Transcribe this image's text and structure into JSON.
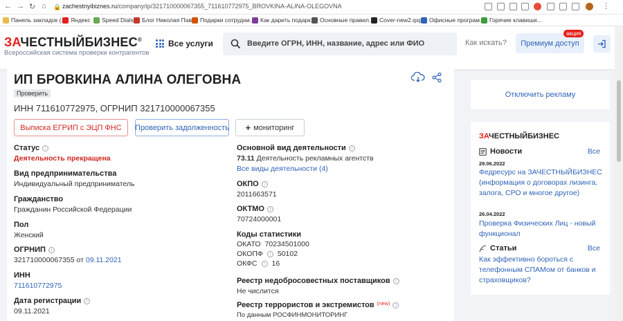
{
  "browser": {
    "url_host": "zachestnyibiznes.ru",
    "url_path": "/company/ip/321710000067355_711610772975_BROVKINA-ALINA-OLEGOVNA",
    "bookmarks": [
      {
        "label": "Панель закладок (...",
        "color": "#e9b94a"
      },
      {
        "label": "Яндекс",
        "color": "#e3201b"
      },
      {
        "label": "Speed Dials",
        "color": "#6aa84f"
      },
      {
        "label": "Блог Николая Пав...",
        "color": "#c0392b"
      },
      {
        "label": "Подарки сотрудни...",
        "color": "#d35400"
      },
      {
        "label": "Как дарить подарк...",
        "color": "#7d3c98"
      },
      {
        "label": "Основные правил...",
        "color": "#555555"
      },
      {
        "label": "Cover-new2.qxp",
        "color": "#222222"
      },
      {
        "label": "Офисные програм...",
        "color": "#2f63b8"
      },
      {
        "label": "Горячие клавиши...",
        "color": "#3a9d3a"
      }
    ]
  },
  "header": {
    "logo_red": "ЗА",
    "logo_black": "ЧЕСТНЫЙБИЗНЕС",
    "logo_mark": "®",
    "logo_sub": "Всероссийская система проверки контрагентов",
    "services": "Все услуги",
    "search_placeholder": "Введите ОГРН, ИНН, название, адрес или ФИО",
    "how_to_search": "Как искать?",
    "premium": "Премиум доступ",
    "premium_badge": "акция"
  },
  "company": {
    "title": "ИП БРОВКИНА АЛИНА ОЛЕГОВНА",
    "verify_tag": "Проверить",
    "inn_line": "ИНН 711610772975, ОГРНИП 321710000067355",
    "btn_egrip": "Выписка ЕГРИП с ЭЦП ФНС",
    "btn_debt": "Проверить задолженность",
    "btn_monitor": "мониторинг"
  },
  "left": {
    "status_label": "Статус",
    "status_value": "Деятельность прекращена",
    "type_label": "Вид предпринимательства",
    "type_value": "Индивидуальный предприниматель",
    "citizenship_label": "Гражданство",
    "citizenship_value": "Гражданин Российской Федерации",
    "sex_label": "Пол",
    "sex_value": "Женский",
    "ogrnip_label": "ОГРНИП",
    "ogrnip_value": "321710000067355",
    "ogrnip_from": "от",
    "ogrnip_date": "09.11.2021",
    "inn_label": "ИНН",
    "inn_value": "711610772975",
    "reg_label": "Дата регистрации",
    "reg_value": "09.11.2021"
  },
  "right": {
    "activity_label": "Основной вид деятельности",
    "activity_code": "73.11",
    "activity_value": "Деятельность рекламных агентств",
    "activity_all": "Все виды деятельности (4)",
    "okpo_label": "ОКПО",
    "okpo_value": "2011663571",
    "oktmo_label": "ОКТМО",
    "oktmo_value": "70724000001",
    "codes_label": "Коды статистики",
    "okato_label": "ОКАТО",
    "okato_value": "70234501000",
    "okopf_label": "ОКОПФ",
    "okopf_value": "50102",
    "okfs_label": "ОКФС",
    "okfs_value": "16",
    "registry_label": "Реестр недобросовестных поставщиков",
    "registry_value": "Не числится",
    "terror_label": "Реестр террористов и экстремистов",
    "terror_new": "(new)",
    "terror_value": "По данным РОСФИНМОНИТОРИНГ"
  },
  "sidebar": {
    "ad_off": "Отключить рекламу",
    "logo_red": "ЗА",
    "logo_black": "ЧЕСТНЫЙБИЗНЕС",
    "news_label": "Новости",
    "all_label": "Все",
    "news": [
      {
        "date": "29.06.2022",
        "text": "Федресурс на ЗАЧЕСТНЫЙБИЗНЕС (информация о договорах лизинга, залога, СРО и многое другое)"
      },
      {
        "date": "26.04.2022",
        "text": "Проверка Физических Лиц - новый функционал"
      }
    ],
    "articles_label": "Статьи",
    "article_text": "Как эффективно бороться с телефонным СПАМом от банков и страховщиков?"
  }
}
